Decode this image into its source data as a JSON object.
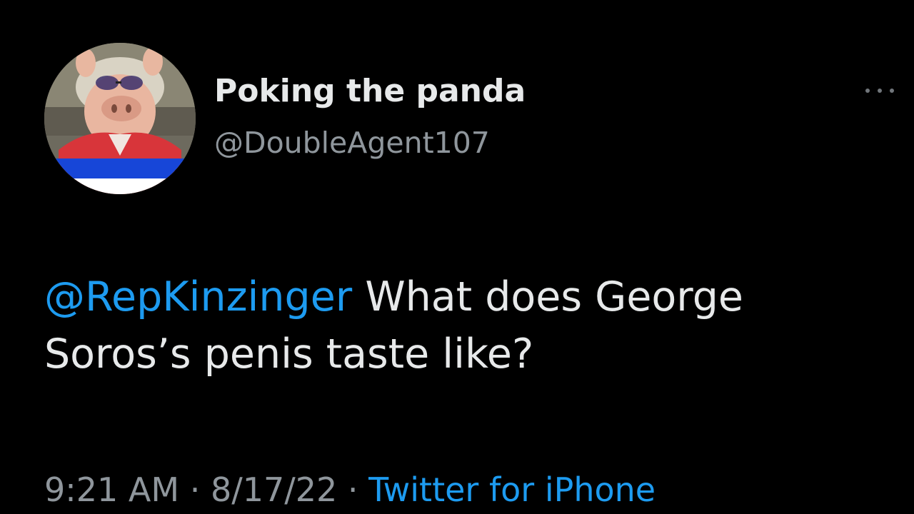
{
  "author": {
    "display_name": "Poking the panda",
    "handle": "@DoubleAgent107"
  },
  "tweet": {
    "mention": "@RepKinzinger",
    "text_after_mention": " What does George Soros’s penis taste like?"
  },
  "meta": {
    "time": "9:21 AM",
    "separator": " · ",
    "date": "8/17/22",
    "source": "Twitter for iPhone"
  },
  "icons": {
    "more": "more-horizontal-icon",
    "avatar": "profile-avatar"
  },
  "colors": {
    "background": "#000000",
    "text_primary": "#e7e9ea",
    "text_secondary": "#8f969c",
    "accent": "#1d9bf0"
  }
}
